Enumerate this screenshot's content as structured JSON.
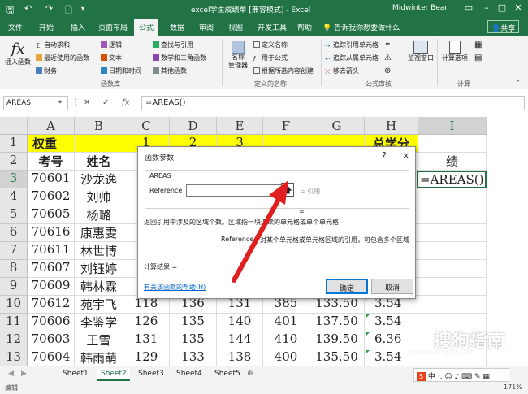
{
  "titlebar": {
    "title": "excel学生成绩单 [兼容模式] - Excel",
    "user": "Midwinter Bear",
    "save_icon": "save-icon",
    "undo_icon": "undo-icon",
    "redo_icon": "redo-icon",
    "new_icon": "new-file-icon",
    "customize_icon": "customize-icon"
  },
  "tabs": [
    "文件",
    "开始",
    "插入",
    "页面布局",
    "公式",
    "数据",
    "审阅",
    "视图",
    "开发工具",
    "帮助",
    "告诉我你想要做什么"
  ],
  "share": "共享",
  "ribbon": {
    "insert_function": "插入函数",
    "autosum": "自动求和",
    "recent": "最近使用的函数",
    "financial": "财务",
    "logical": "逻辑",
    "text": "文本",
    "datetime": "日期和时间",
    "lookup": "查找与引用",
    "math": "数学和三角函数",
    "more": "其他函数",
    "group_library": "函数库",
    "name_manager": "名称\n管理器",
    "define_name": "定义名称",
    "use_in_formula": "用于公式",
    "create_from_selection": "根据所选内容创建",
    "group_names": "定义的名称",
    "trace_precedents": "追踪引用单元格",
    "trace_dependents": "追踪从属单元格",
    "remove_arrows": "移去箭头",
    "group_audit": "公式审核",
    "watch_window": "监视窗口",
    "calc_options": "计算选项",
    "group_calc": "计算"
  },
  "formula_bar": {
    "name_box": "AREAS",
    "formula": "=AREAS()",
    "cancel": "✕",
    "enter": "✓",
    "fx": "fx"
  },
  "columns": [
    "A",
    "B",
    "C",
    "D",
    "E",
    "F",
    "G",
    "H",
    "I"
  ],
  "rows": [
    "1",
    "2",
    "3",
    "4",
    "5",
    "6",
    "7",
    "8",
    "9",
    "10",
    "11",
    "12",
    "13"
  ],
  "cells": {
    "r1": [
      "权重",
      "",
      "1",
      "2",
      "3",
      "",
      "",
      "总学分",
      ""
    ],
    "r2": [
      "考号",
      "姓名",
      "",
      "",
      "",
      "",
      "",
      "",
      "绩"
    ],
    "r3": [
      "70601",
      "沙龙逸",
      "",
      "",
      "",
      "",
      "",
      "",
      ""
    ],
    "r4": [
      "70602",
      "刘帅",
      "",
      "",
      "",
      "",
      "",
      "",
      ""
    ],
    "r5": [
      "70605",
      "杨璐",
      "",
      "",
      "",
      "",
      "",
      "",
      ""
    ],
    "r6": [
      "70616",
      "康惠雯",
      "",
      "",
      "",
      "",
      "",
      "",
      ""
    ],
    "r7": [
      "70611",
      "林世博",
      "",
      "",
      "",
      "",
      "",
      "",
      ""
    ],
    "r8": [
      "70607",
      "刘钰婷",
      "",
      "",
      "",
      "",
      "",
      "",
      ""
    ],
    "r9": [
      "70609",
      "韩林霖",
      "",
      "",
      "",
      "",
      "",
      "",
      ""
    ],
    "r10": [
      "70612",
      "苑宇飞",
      "118",
      "136",
      "131",
      "385",
      "133.50",
      "3.54",
      ""
    ],
    "r11": [
      "70606",
      "李鉴学",
      "126",
      "135",
      "140",
      "401",
      "137.50",
      "3.54",
      ""
    ],
    "r12": [
      "70603",
      "王雪",
      "131",
      "135",
      "144",
      "410",
      "139.50",
      "6.36",
      ""
    ],
    "r13": [
      "70604",
      "韩雨萌",
      "129",
      "133",
      "138",
      "400",
      "135.50",
      "3.54",
      ""
    ]
  },
  "active_cell_text": "=AREAS()",
  "dialog": {
    "title": "函数参数",
    "help_btn": "?",
    "close_btn": "×",
    "function_name": "AREAS",
    "arg_label": "Reference",
    "arg_result": "=  引用",
    "eq": "=",
    "description": "返回引用中涉及的区域个数。区域指一块连续的单元格或单个单元格",
    "arg_desc_label": "Reference",
    "arg_desc": "对某个单元格或单元格区域的引用，可包含多个区域",
    "result": "计算结果 =",
    "help_link": "有关该函数的帮助(H)",
    "ok": "确定",
    "cancel": "取消"
  },
  "sheets": [
    "Sheet1",
    "Sheet2",
    "Sheet3",
    "Sheet4",
    "Sheet5"
  ],
  "active_sheet_index": 1,
  "status": {
    "mode": "编辑",
    "zoom": "171%"
  },
  "watermark": {
    "main": "搜狗指南",
    "sub": "zhinan.sogou.com"
  },
  "colors": {
    "excel_green": "#217346",
    "highlight_yellow": "#ffff00",
    "arrow_red": "#e02020"
  }
}
